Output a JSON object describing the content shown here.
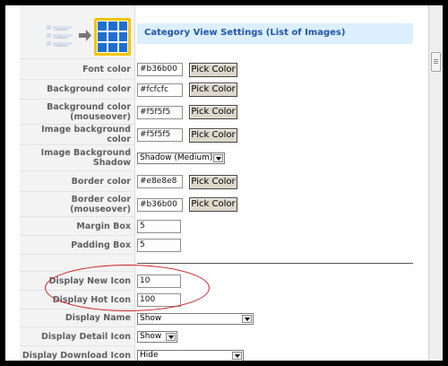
{
  "section_title": "Category View Settings (List of Images)",
  "illustration": {
    "list_lines": [
      "Category",
      "Category",
      "Category"
    ],
    "icon": "arrow-right-icon",
    "grid_icon": "image-grid-icon"
  },
  "colors": {
    "title_bar": "#dcefff",
    "title_text": "#2255aa",
    "label_bg": "#f3f3f3",
    "annotation_ellipse": "#cc2020"
  },
  "pick_color_label": "Pick Color",
  "color_fields": [
    {
      "label": "Font color",
      "value": "#b36b00"
    },
    {
      "label": "Background color",
      "value": "#fcfcfc"
    },
    {
      "label": "Background color (mouseover)",
      "value": "#f5f5f5"
    },
    {
      "label": "Image background color",
      "value": "#f5f5f5"
    }
  ],
  "image_shadow": {
    "label": "Image Background Shadow",
    "value": "Shadow (Medium)"
  },
  "border_fields": [
    {
      "label": "Border color",
      "value": "#e8e8e8"
    },
    {
      "label": "Border color (mouseover)",
      "value": "#b36b00"
    }
  ],
  "margin_box": {
    "label": "Margin Box",
    "value": "5"
  },
  "padding_box": {
    "label": "Padding Box",
    "value": "5"
  },
  "new_icon": {
    "label": "Display New Icon",
    "value": "10"
  },
  "hot_icon": {
    "label": "Display Hot Icon",
    "value": "100"
  },
  "display_name": {
    "label": "Display Name",
    "value": "Show"
  },
  "detail_icon": {
    "label": "Display Detail Icon",
    "value": "Show"
  },
  "download_icon": {
    "label": "Display Download Icon",
    "value": "Hide"
  }
}
